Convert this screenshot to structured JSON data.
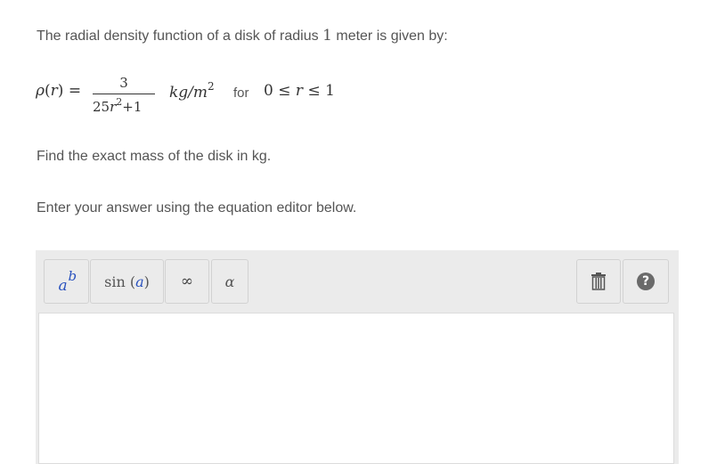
{
  "intro": {
    "before": "The radial density function of a disk of radius",
    "number": "1",
    "after": "meter is given by:"
  },
  "formula": {
    "lhs_rho": "ρ",
    "lhs_open": "(",
    "lhs_var": "r",
    "lhs_close": ")",
    "equals": " =",
    "numerator": "3",
    "den_coef": "25",
    "den_var": "r",
    "den_exp": "2",
    "den_plus": "+1",
    "unit": "kg/m",
    "unit_exp": "2",
    "for_label": "for",
    "range_low": "0",
    "range_le1": "≤",
    "range_var": "r",
    "range_le2": "≤",
    "range_high": "1"
  },
  "question": "Find the exact mass of the disk in kg.",
  "instruction": "Enter your answer using the equation editor below.",
  "toolbar": {
    "power": {
      "base": "a",
      "exponent": "b"
    },
    "sin": {
      "prefix": "sin (",
      "arg": "a",
      "suffix": ")"
    },
    "infinity": "∞",
    "alpha": "α",
    "help": "?"
  },
  "icons": {
    "trash": "trash-icon",
    "help": "help-icon"
  },
  "colors": {
    "accent_blue": "#2a52be",
    "toolbar_bg": "#ebebeb",
    "text": "#555555"
  }
}
